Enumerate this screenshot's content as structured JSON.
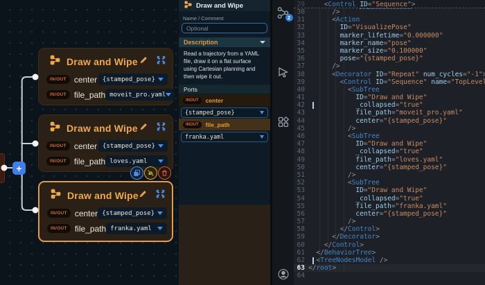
{
  "canvas": {
    "add_button_label": "+",
    "nodes": [
      {
        "title": "Draw and Wipe",
        "ports": [
          {
            "badge": "IN/OUT",
            "name": "center",
            "value": "{stamped_pose}"
          },
          {
            "badge": "IN/OUT",
            "name": "file_path",
            "value": "moveit_pro.yaml"
          }
        ]
      },
      {
        "title": "Draw and Wipe",
        "ports": [
          {
            "badge": "IN/OUT",
            "name": "center",
            "value": "{stamped_pose}"
          },
          {
            "badge": "IN/OUT",
            "name": "file_path",
            "value": "loves.yaml"
          }
        ]
      },
      {
        "title": "Draw and Wipe",
        "ports": [
          {
            "badge": "IN/OUT",
            "name": "center",
            "value": "{stamped_pose}"
          },
          {
            "badge": "IN/OUT",
            "name": "file_path",
            "value": "franka.yaml"
          }
        ]
      }
    ]
  },
  "panel": {
    "title": "Draw and Wipe",
    "name_comment_label": "Name / Comment",
    "name_input_placeholder": "Optional",
    "description_header": "Description",
    "description_text": "Read a trajectory from a YAML file, draw it on a flat surface using Cartesian planning and then wipe it out.",
    "ports_header": "Ports",
    "ports": [
      {
        "badge": "INOUT",
        "name": "center",
        "value": "{stamped_pose}",
        "selected": false
      },
      {
        "badge": "INOUT",
        "name": "file_path",
        "value": "franka.yaml",
        "selected": true
      }
    ]
  },
  "editor": {
    "activity_badge": "2",
    "sticky": {
      "n": 29,
      "ind": 4,
      "tokens": [
        [
          "p",
          "<"
        ],
        [
          "t",
          "Control"
        ],
        [
          "s",
          " "
        ],
        [
          "a u",
          "ID"
        ],
        [
          "p u",
          "="
        ],
        [
          "v u",
          "\"Sequence\""
        ],
        [
          "p",
          ">"
        ]
      ]
    },
    "lines": [
      {
        "n": 30,
        "ind": 6,
        "tokens": [
          [
            "p",
            "/>"
          ]
        ]
      },
      {
        "n": 31,
        "ind": 6,
        "tokens": [
          [
            "p",
            "<"
          ],
          [
            "t",
            "Action"
          ]
        ]
      },
      {
        "n": 32,
        "ind": 8,
        "tokens": [
          [
            "a",
            "ID"
          ],
          [
            "p",
            "="
          ],
          [
            "v",
            "\"VisualizePose\""
          ]
        ]
      },
      {
        "n": 33,
        "ind": 8,
        "tokens": [
          [
            "a",
            "marker_lifetime"
          ],
          [
            "p",
            "="
          ],
          [
            "v",
            "\"0.000000\""
          ]
        ]
      },
      {
        "n": 34,
        "ind": 8,
        "tokens": [
          [
            "a",
            "marker_name"
          ],
          [
            "p",
            "="
          ],
          [
            "v",
            "\"pose\""
          ]
        ]
      },
      {
        "n": 35,
        "ind": 8,
        "tokens": [
          [
            "a",
            "marker_size"
          ],
          [
            "p",
            "="
          ],
          [
            "v",
            "\"0.100000\""
          ]
        ]
      },
      {
        "n": 36,
        "ind": 8,
        "tokens": [
          [
            "a",
            "pose"
          ],
          [
            "p",
            "="
          ],
          [
            "v",
            "\"{stamped_pose}\""
          ]
        ]
      },
      {
        "n": 37,
        "ind": 6,
        "tokens": [
          [
            "p",
            "/>"
          ]
        ]
      },
      {
        "n": 38,
        "ind": 6,
        "tokens": [
          [
            "p",
            "<"
          ],
          [
            "t",
            "Decorator"
          ],
          [
            "s",
            " "
          ],
          [
            "a",
            "ID"
          ],
          [
            "p",
            "="
          ],
          [
            "v",
            "\"Repeat\""
          ],
          [
            "s",
            " "
          ],
          [
            "a",
            "num_cycles"
          ],
          [
            "p",
            "="
          ],
          [
            "v",
            "\"-1\""
          ],
          [
            "p",
            ">"
          ]
        ]
      },
      {
        "n": 39,
        "ind": 8,
        "tokens": [
          [
            "p",
            "<"
          ],
          [
            "t",
            "Control"
          ],
          [
            "s",
            " "
          ],
          [
            "a",
            "ID"
          ],
          [
            "p",
            "="
          ],
          [
            "v",
            "\"Sequence\""
          ],
          [
            "s",
            " "
          ],
          [
            "a",
            "name"
          ],
          [
            "p",
            "="
          ],
          [
            "v",
            "\"TopLevelSequence\""
          ],
          [
            "p",
            ">"
          ]
        ]
      },
      {
        "n": 40,
        "ind": 10,
        "tokens": [
          [
            "p",
            "<"
          ],
          [
            "t",
            "SubTree"
          ]
        ]
      },
      {
        "n": 41,
        "ind": 12,
        "tokens": [
          [
            "a",
            "ID"
          ],
          [
            "p",
            "="
          ],
          [
            "v",
            "\"Draw and Wipe\""
          ]
        ]
      },
      {
        "n": 42,
        "ind": 12,
        "cursor": true,
        "tokens": [
          [
            "a",
            "_collapsed"
          ],
          [
            "p",
            "="
          ],
          [
            "v",
            "\"true\""
          ]
        ]
      },
      {
        "n": 43,
        "ind": 12,
        "tokens": [
          [
            "a",
            "file_path"
          ],
          [
            "p",
            "="
          ],
          [
            "v",
            "\"moveit_pro.yaml\""
          ]
        ]
      },
      {
        "n": 44,
        "ind": 12,
        "tokens": [
          [
            "a",
            "center"
          ],
          [
            "p",
            "="
          ],
          [
            "v",
            "\"{stamped_pose}\""
          ]
        ]
      },
      {
        "n": 45,
        "ind": 10,
        "tokens": [
          [
            "p",
            "/>"
          ]
        ]
      },
      {
        "n": 46,
        "ind": 10,
        "tokens": [
          [
            "p",
            "<"
          ],
          [
            "t",
            "SubTree"
          ]
        ]
      },
      {
        "n": 47,
        "ind": 12,
        "tokens": [
          [
            "a",
            "ID"
          ],
          [
            "p",
            "="
          ],
          [
            "v",
            "\"Draw and Wipe\""
          ]
        ]
      },
      {
        "n": 48,
        "ind": 12,
        "tokens": [
          [
            "a",
            "_collapsed"
          ],
          [
            "p",
            "="
          ],
          [
            "v",
            "\"true\""
          ]
        ]
      },
      {
        "n": 49,
        "ind": 12,
        "tokens": [
          [
            "a",
            "file_path"
          ],
          [
            "p",
            "="
          ],
          [
            "v",
            "\"loves.yaml\""
          ]
        ]
      },
      {
        "n": 50,
        "ind": 12,
        "tokens": [
          [
            "a",
            "center"
          ],
          [
            "p",
            "="
          ],
          [
            "v",
            "\"{stamped_pose}\""
          ]
        ]
      },
      {
        "n": 51,
        "ind": 10,
        "tokens": [
          [
            "p",
            "/>"
          ]
        ]
      },
      {
        "n": 52,
        "ind": 10,
        "tokens": [
          [
            "p",
            "<"
          ],
          [
            "t",
            "SubTree"
          ]
        ]
      },
      {
        "n": 53,
        "ind": 12,
        "tokens": [
          [
            "a",
            "ID"
          ],
          [
            "p",
            "="
          ],
          [
            "v",
            "\"Draw and Wipe\""
          ]
        ]
      },
      {
        "n": 54,
        "ind": 12,
        "tokens": [
          [
            "a",
            "_collapsed"
          ],
          [
            "p",
            "="
          ],
          [
            "v",
            "\"true\""
          ]
        ]
      },
      {
        "n": 55,
        "ind": 12,
        "tokens": [
          [
            "a",
            "file_path"
          ],
          [
            "p",
            "="
          ],
          [
            "v",
            "\"franka.yaml\""
          ]
        ]
      },
      {
        "n": 56,
        "ind": 12,
        "tokens": [
          [
            "a",
            "center"
          ],
          [
            "p",
            "="
          ],
          [
            "v",
            "\"{stamped_pose}\""
          ]
        ]
      },
      {
        "n": 57,
        "ind": 10,
        "tokens": [
          [
            "p",
            "/>"
          ]
        ]
      },
      {
        "n": 58,
        "ind": 8,
        "tokens": [
          [
            "p",
            "</"
          ],
          [
            "t",
            "Control"
          ],
          [
            "p",
            ">"
          ]
        ]
      },
      {
        "n": 59,
        "ind": 6,
        "tokens": [
          [
            "p",
            "</"
          ],
          [
            "t",
            "Decorator"
          ],
          [
            "p",
            ">"
          ]
        ]
      },
      {
        "n": 60,
        "ind": 4,
        "tokens": [
          [
            "p",
            "</"
          ],
          [
            "t",
            "Control"
          ],
          [
            "p",
            ">"
          ]
        ]
      },
      {
        "n": 61,
        "ind": 2,
        "tokens": [
          [
            "p",
            "</"
          ],
          [
            "t",
            "BehaviorTree"
          ],
          [
            "p",
            ">"
          ]
        ]
      },
      {
        "n": 62,
        "ind": 2,
        "cursor": true,
        "tokens": [
          [
            "p",
            "<"
          ],
          [
            "t",
            "TreeNodesModel"
          ],
          [
            "p",
            " />"
          ]
        ]
      },
      {
        "n": 63,
        "ind": 0,
        "current": true,
        "tokens": [
          [
            "p",
            "</"
          ],
          [
            "t",
            "root"
          ],
          [
            "p",
            ">"
          ]
        ]
      },
      {
        "n": 64,
        "ind": 0,
        "tokens": []
      }
    ]
  },
  "colors": {
    "accent_orange": "#e79c42",
    "accent_blue": "#4d8fe8",
    "selected_border": "#e29d4b",
    "wire": "#ccd0d4"
  }
}
